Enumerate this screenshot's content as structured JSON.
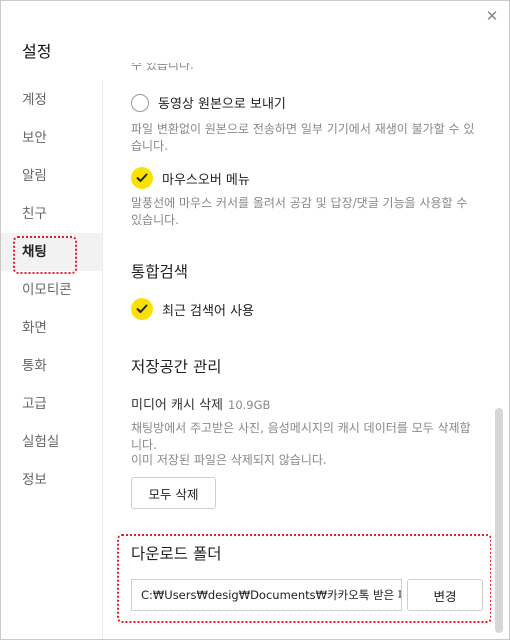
{
  "window": {
    "title": "설정",
    "close_glyph": "✕"
  },
  "sidebar": {
    "items": [
      {
        "label": "계정",
        "active": false
      },
      {
        "label": "보안",
        "active": false
      },
      {
        "label": "알림",
        "active": false
      },
      {
        "label": "친구",
        "active": false
      },
      {
        "label": "채팅",
        "active": true
      },
      {
        "label": "이모티콘",
        "active": false
      },
      {
        "label": "화면",
        "active": false
      },
      {
        "label": "통화",
        "active": false
      },
      {
        "label": "고급",
        "active": false
      },
      {
        "label": "실험실",
        "active": false
      },
      {
        "label": "정보",
        "active": false
      }
    ]
  },
  "content": {
    "cut_text": "수 있습니다.",
    "original_video": {
      "label": "동영상 원본으로 보내기",
      "checked": false,
      "desc": "파일 변환없이 원본으로 전송하면 일부 기기에서 재생이 불가할 수 있습니다."
    },
    "mouseover_menu": {
      "label": "마우스오버 메뉴",
      "checked": true,
      "desc": "말풍선에 마우스 커서를 올려서 공감 및 답장/댓글 기능을 사용할 수 있습니다."
    },
    "search_section": {
      "title": "통합검색",
      "recent_search": {
        "label": "최근 검색어 사용",
        "checked": true
      }
    },
    "storage_section": {
      "title": "저장공간 관리",
      "media_cache_label": "미디어 캐시 삭제",
      "media_cache_size": "10.9GB",
      "desc_line1": "채팅방에서 주고받은 사진, 음성메시지의 캐시 데이터를 모두 삭제합니다.",
      "desc_line2": "이미 저장된 파일은 삭제되지 않습니다.",
      "delete_all_button": "모두 삭제"
    },
    "download_section": {
      "title": "다운로드 폴더",
      "path_value": "C:₩Users₩desig₩Documents₩카카오톡 받은 파일",
      "change_button": "변경"
    }
  },
  "colors": {
    "check_fill": "#fae100",
    "highlight": "#e0202a"
  }
}
